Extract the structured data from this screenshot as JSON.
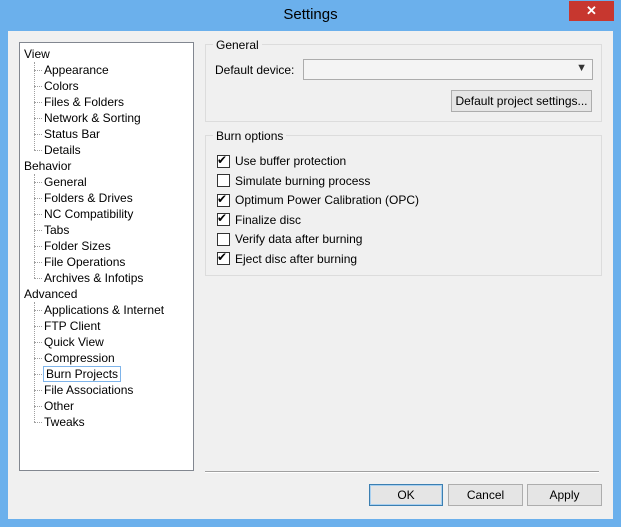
{
  "window": {
    "title": "Settings",
    "close_glyph": "✕"
  },
  "tree": {
    "groups": [
      {
        "label": "View",
        "children": [
          "Appearance",
          "Colors",
          "Files & Folders",
          "Network & Sorting",
          "Status Bar",
          "Details"
        ]
      },
      {
        "label": "Behavior",
        "children": [
          "General",
          "Folders & Drives",
          "NC Compatibility",
          "Tabs",
          "Folder Sizes",
          "File Operations",
          "Archives & Infotips"
        ]
      },
      {
        "label": "Advanced",
        "children": [
          "Applications & Internet",
          "FTP Client",
          "Quick View",
          "Compression",
          "Burn Projects",
          "File Associations",
          "Other",
          "Tweaks"
        ]
      }
    ],
    "selected": "Burn Projects"
  },
  "general": {
    "title": "General",
    "default_device_label": "Default device:",
    "default_device_value": "",
    "project_settings_button": "Default project settings..."
  },
  "burn_options": {
    "title": "Burn options",
    "items": [
      {
        "label": "Use buffer protection",
        "checked": true
      },
      {
        "label": "Simulate burning process",
        "checked": false
      },
      {
        "label": "Optimum Power Calibration (OPC)",
        "checked": true
      },
      {
        "label": "Finalize disc",
        "checked": true
      },
      {
        "label": "Verify data after burning",
        "checked": false
      },
      {
        "label": "Eject disc after burning",
        "checked": true
      }
    ]
  },
  "footer": {
    "ok": "OK",
    "cancel": "Cancel",
    "apply": "Apply"
  }
}
